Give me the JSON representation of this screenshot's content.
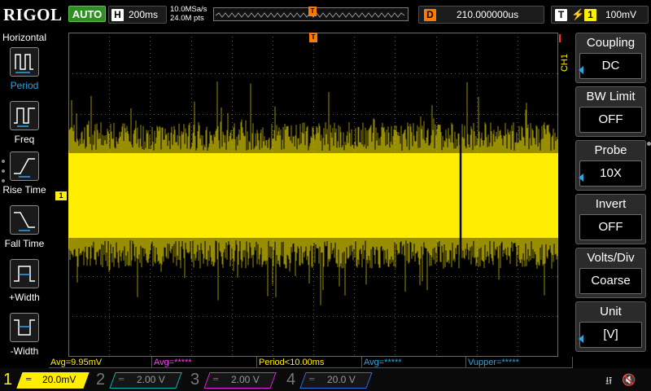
{
  "brand": "RIGOL",
  "run_state": "AUTO",
  "timebase": {
    "key": "H",
    "value": "200ms"
  },
  "sampling": {
    "rate": "10.0MSa/s",
    "points": "24.0M pts"
  },
  "memory_bar": {
    "trigger_marker": "T"
  },
  "delay": {
    "key": "D",
    "value": "210.000000us"
  },
  "trigger": {
    "key": "T",
    "source": "1",
    "level": "100mV",
    "slope_icon": "rising-edge-icon"
  },
  "left_panel": {
    "title": "Horizontal",
    "items": [
      {
        "label": "Period",
        "icon": "period-icon"
      },
      {
        "label": "Freq",
        "icon": "frequency-icon"
      },
      {
        "label": "Rise Time",
        "icon": "rise-time-icon"
      },
      {
        "label": "Fall Time",
        "icon": "fall-time-icon"
      },
      {
        "label": "+Width",
        "icon": "positive-width-icon"
      },
      {
        "label": "-Width",
        "icon": "negative-width-icon"
      }
    ]
  },
  "waveform": {
    "channel_marker": "1",
    "trigger_marker": "T",
    "color": "#ffee00"
  },
  "right_menu": {
    "channel_tab": "CH1",
    "items": [
      {
        "title": "Coupling",
        "value": "DC"
      },
      {
        "title": "BW Limit",
        "value": "OFF"
      },
      {
        "title": "Probe",
        "value": "10X"
      },
      {
        "title": "Invert",
        "value": "OFF"
      },
      {
        "title": "Volts/Div",
        "value": "Coarse"
      },
      {
        "title": "Unit",
        "value": "[V]"
      }
    ]
  },
  "measurements": [
    {
      "text": "Avg=9.95mV",
      "color": "#ffee00"
    },
    {
      "text": "Avg=*****",
      "color": "#ff3cff"
    },
    {
      "text": "Period<10.00ms",
      "color": "#ffee00"
    },
    {
      "text": "Avg=*****",
      "color": "#2aa6e6"
    },
    {
      "text": "Vupper=*****",
      "color": "#2aa6e6"
    }
  ],
  "channels": [
    {
      "num": "1",
      "scale": "20.0mV",
      "color": "#ffee00",
      "active": true
    },
    {
      "num": "2",
      "scale": "2.00 V",
      "color": "#00b8b0",
      "active": false
    },
    {
      "num": "3",
      "scale": "2.00 V",
      "color": "#e020e0",
      "active": false
    },
    {
      "num": "4",
      "scale": "20.0 V",
      "color": "#2a70d8",
      "active": false
    }
  ],
  "status_icons": {
    "usb": "usb-icon",
    "sound": "speaker-muted-icon"
  }
}
